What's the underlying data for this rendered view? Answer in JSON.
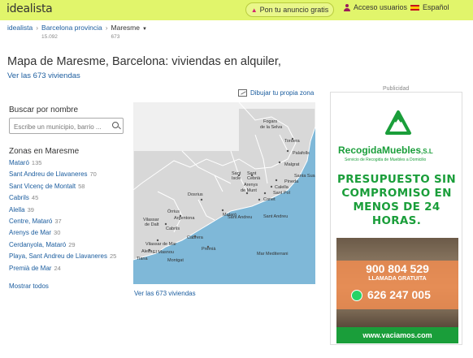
{
  "topbar": {
    "logo": "idealista",
    "post_ad": "Pon tu anuncio gratis",
    "login": "Acceso usuarios",
    "language": "Español",
    "bg_color": "#e1f56b"
  },
  "breadcrumb": {
    "items": [
      {
        "label": "idealista",
        "count": ""
      },
      {
        "label": "Barcelona provincia",
        "count": "15.092"
      },
      {
        "label": "Maresme",
        "count": "673"
      }
    ]
  },
  "main": {
    "title": "Mapa de Maresme, Barcelona: viviendas en alquiler,",
    "see_all_top": "Ver las 673 viviendas",
    "draw_zone": "Dibujar tu propia zona",
    "see_all_bottom": "Ver las 673 viviendas"
  },
  "search": {
    "label": "Buscar por nombre",
    "placeholder": "Escribe un municipio, barrio ..."
  },
  "zones": {
    "title": "Zonas en Maresme",
    "items": [
      {
        "name": "Mataró",
        "count": "135"
      },
      {
        "name": "Sant Andreu de Llavaneres",
        "count": "70"
      },
      {
        "name": "Sant Vicenç de Montalt",
        "count": "58"
      },
      {
        "name": "Cabrils",
        "count": "45"
      },
      {
        "name": "Alella",
        "count": "39"
      },
      {
        "name": "Centre, Mataró",
        "count": "37"
      },
      {
        "name": "Arenys de Mar",
        "count": "30"
      },
      {
        "name": "Cerdanyola, Mataró",
        "count": "29"
      },
      {
        "name": "Playa, Sant Andreu de Llavaneres",
        "count": "25"
      },
      {
        "name": "Premià de Mar",
        "count": "24"
      }
    ],
    "show_all": "Mostrar todos"
  },
  "map": {
    "labels": [
      "Fogars de la Selva",
      "Tordera",
      "Palafolls",
      "Malgrat",
      "Santa Susanna",
      "Pineda",
      "Calella",
      "Sant Pol",
      "Canet",
      "Arenys de Munt",
      "Sant Iscle",
      "Sant Cebrià",
      "Sant Andreu",
      "Dosrius",
      "Mataró",
      "Argentona",
      "Òrrius",
      "Vilassar de Dalt",
      "Cabrils",
      "Vilassar de Mar",
      "Cabrera",
      "Premià",
      "Alella",
      "Tiana",
      "Montgat",
      "El Masnou",
      "Mar Mediterrani"
    ],
    "sea_color": "#7fb8d8",
    "land_color": "#d8d8d8"
  },
  "ad": {
    "label": "Publicidad",
    "brand": "RecogidaMuebles",
    "brand_suffix": ",S.L",
    "tagline": "Servicio de Recogida de Muebles a Domicilio",
    "headline": "PRESUPUESTO SIN COMPROMISO EN MENOS DE 24 HORAS.",
    "phone": "900 804 529",
    "call_text": "LLAMADA GRATUITA",
    "whatsapp": "626 247 005",
    "url": "www.vaciamos.com",
    "brand_color": "#1a9e3a"
  }
}
